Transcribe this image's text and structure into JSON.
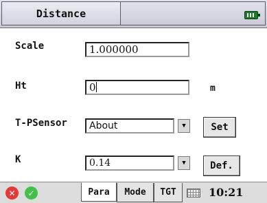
{
  "window": {
    "title": "Distance",
    "status_icon": "battery-icon"
  },
  "form": {
    "scale": {
      "label": "Scale",
      "value": "1.000000"
    },
    "ht": {
      "label": "Ht",
      "value": "0",
      "unit": "m"
    },
    "tpsensor": {
      "label": "T-PSensor",
      "selected": "About",
      "button": "Set"
    },
    "k": {
      "label": "K",
      "selected": "0.14",
      "button": "Def."
    }
  },
  "taskbar": {
    "cancel_icon": "close-icon",
    "ok_icon": "check-icon",
    "tabs": [
      {
        "label": "Para",
        "active": true
      },
      {
        "label": "Mode",
        "active": false
      },
      {
        "label": "TGT",
        "active": false
      }
    ],
    "keyboard_icon": "keyboard-icon",
    "time": "10:21"
  },
  "colors": {
    "cancel": "#e53935",
    "ok": "#43c04a",
    "battery": "#1d7a2a"
  }
}
